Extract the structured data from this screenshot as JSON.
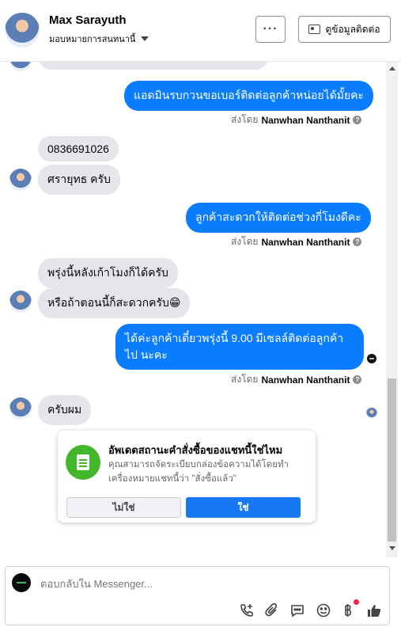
{
  "header": {
    "name": "Max Sarayuth",
    "assign_label": "มอบหมายการสนทนานี้",
    "more_label": "···",
    "contact_info_label": "ดูข้อมูลติดต่อ"
  },
  "messages": {
    "m1": "แอดมินรบกวนขอเบอร์ติดต่อลูกค้าหน่อยได้มั้ยคะ",
    "m2": "0836691026",
    "m3": "ศรายุทธ   ครับ",
    "m4": "ลูกค้าสะดวกให้ติดต่อช่วงกี่โมงดีคะ",
    "m5": "พรุ่งนี้หลังเก้าโมงก็ได้ครับ",
    "m6": "หรือถ้าตอนนี้ก็สะดวกครับ😁",
    "m7": "ได้ค่ะลูกค้าเดี๋ยวพรุ่งนี้ 9.00 มีเซลล์ติดต่อลูกค้าไป นะคะ",
    "m8": "ครับผม"
  },
  "sent_by": {
    "prefix": "ส่งโดย",
    "name": "Nanwhan Nanthanit",
    "help": "?"
  },
  "status_card": {
    "title": "อัพเดตสถานะคำสั่งซื้อของแชทนี้ใช่ไหม",
    "description": "คุณสามารถจัดระเบียบกล่องข้อความได้โดยทำเครื่องหมายแชทนี้ว่า \"สั่งซื้อแล้ว\"",
    "no_label": "ไม่ใช่",
    "yes_label": "ใช่"
  },
  "composer": {
    "placeholder": "ตอบกลับใน Messenger..."
  },
  "icons": [
    "phone-plus-icon",
    "attachment-icon",
    "saved-reply-icon",
    "emoji-icon",
    "baht-icon",
    "thumbs-up-icon"
  ],
  "colors": {
    "outgoing_bubble": "#0a7cff",
    "incoming_bubble": "#e4e6eb",
    "primary_button": "#1877f2",
    "card_icon": "#42b72a"
  }
}
